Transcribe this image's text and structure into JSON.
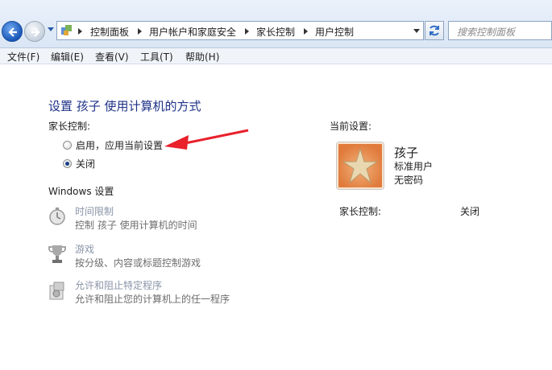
{
  "address": {
    "crumbs": [
      "控制面板",
      "用户帐户和家庭安全",
      "家长控制",
      "用户控制"
    ],
    "search_placeholder": "搜索控制面板"
  },
  "menu": [
    "文件(F)",
    "编辑(E)",
    "查看(V)",
    "工具(T)",
    "帮助(H)"
  ],
  "main": {
    "title": "设置 孩子 使用计算机的方式",
    "parental_label": "家长控制:",
    "options": [
      {
        "label": "启用，应用当前设置",
        "checked": false
      },
      {
        "label": "关闭",
        "checked": true
      }
    ],
    "windows_settings_label": "Windows 设置",
    "settings": [
      {
        "title": "时间限制",
        "desc": "控制 孩子 使用计算机的时间",
        "icon": "stopwatch-icon"
      },
      {
        "title": "游戏",
        "desc": "按分级、内容或标题控制游戏",
        "icon": "trophy-icon"
      },
      {
        "title": "允许和阻止特定程序",
        "desc": "允许和阻止您的计算机上的任一程序",
        "icon": "program-icon"
      }
    ]
  },
  "current": {
    "label": "当前设置:",
    "user_name": "孩子",
    "account_type": "标准用户",
    "password": "无密码",
    "parental_label": "家长控制:",
    "parental_value": "关闭"
  },
  "colors": {
    "title": "#1e3287",
    "annotation": "#e8212b",
    "disabled_link": "#8a95a8"
  }
}
